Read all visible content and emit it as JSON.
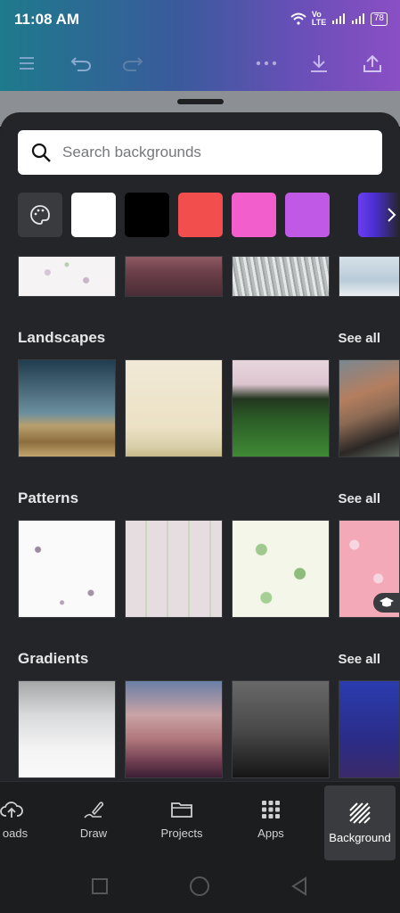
{
  "status": {
    "time": "11:08 AM",
    "network": "Vo LTE",
    "battery": "78"
  },
  "toolbar": {
    "icons": [
      "menu-icon",
      "undo-icon",
      "redo-icon",
      "more-icon",
      "download-icon",
      "share-icon"
    ]
  },
  "search": {
    "placeholder": "Search backgrounds"
  },
  "swatches": [
    "#ffffff",
    "#000000",
    "#f24e4e",
    "#f25ecb",
    "#c05ae6",
    "#6a3ef0"
  ],
  "sections": {
    "landscapes": {
      "title": "Landscapes",
      "see_all": "See all"
    },
    "patterns": {
      "title": "Patterns",
      "see_all": "See all"
    },
    "gradients": {
      "title": "Gradients",
      "see_all": "See all"
    }
  },
  "bottom_nav": {
    "uploads": "oads",
    "draw": "Draw",
    "projects": "Projects",
    "apps": "Apps",
    "background": "Background"
  }
}
